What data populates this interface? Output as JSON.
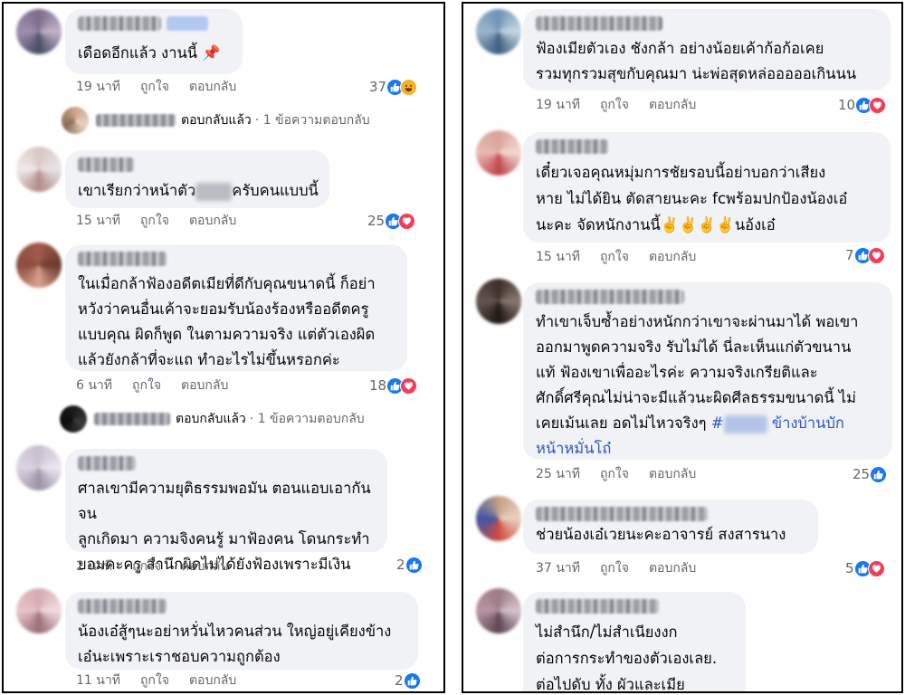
{
  "left_comments": [
    {
      "text": "เดือดอีกแล้ว งานนี้ 📌",
      "time": "19 นาที",
      "like": "ถูกใจ",
      "reply": "ตอบกลับ",
      "reaction_count": "37",
      "reactions": [
        "like",
        "haha"
      ],
      "replies_summary": {
        "replied": "ตอบกลับแล้ว",
        "count_text": "· 1 ข้อความตอบกลับ"
      }
    },
    {
      "text_before": "เขาเรียกว่าหน้าตัว",
      "text_after": "ครับคนแบบนี้",
      "time": "15 นาที",
      "like": "ถูกใจ",
      "reply": "ตอบกลับ",
      "reaction_count": "25",
      "reactions": [
        "like",
        "love"
      ]
    },
    {
      "lines": [
        "ในเมื่อกล้าฟ้องอดีตเมียที่ดีกับคุณขนาดนี้ ก็อย่า",
        "หวังว่าคนอื่นเค้าจะยอมรับน้องร้องหรืออดีตครู",
        "แบบคุณ ผิดก็พูด ในตามความจริง แต่ตัวเองผิด",
        "แล้วยังกล้าที่จะแถ ทำอะไรไม่ขึ้นหรอกค่ะ"
      ],
      "time": "6 นาที",
      "like": "ถูกใจ",
      "reply": "ตอบกลับ",
      "reaction_count": "18",
      "reactions": [
        "like",
        "love"
      ],
      "replies_summary": {
        "replied": "ตอบกลับแล้ว",
        "count_text": "· 1 ข้อความตอบกลับ"
      }
    },
    {
      "lines": [
        "ศาลเขามีความยุติธรรมพอมัน ตอนแอบเอากัน จน",
        "ลูกเกิดมา ความจิงคนรู้ มาฟ้องคน โดนกระทำ",
        "ยอมคะครู สำนึกผิดไม่ได้ยังฟ้องเพราะมีเงิน"
      ],
      "time": "2 นาที",
      "like": "ถูกใจ",
      "reply": "ตอบกลับ",
      "reaction_count": "2",
      "reactions": [
        "like"
      ]
    },
    {
      "lines": [
        "น้องเอ๋สู้ๆนะอย่าหวั่นไหวคนส่วน ใหญ่อยู่เคียงข้าง",
        "เอ๋นะเพราะเราชอบความถูกต้อง"
      ],
      "time": "11 นาที",
      "like": "ถูกใจ",
      "reply": "ตอบกลับ",
      "reaction_count": "2",
      "reactions": [
        "like"
      ]
    }
  ],
  "right_comments": [
    {
      "lines": [
        "ฟ้องเมียตัวเอง ชังกล้า อย่างน้อยเค้าก้อก้อเคย",
        "รวมทุกรวมสุขกับคุณมา น่ะพ่อสุดหล่อออออเกินนน"
      ],
      "time": "19 นาที",
      "like": "ถูกใจ",
      "reply": "ตอบกลับ",
      "reaction_count": "10",
      "reactions": [
        "like",
        "love"
      ]
    },
    {
      "lines": [
        "เดี๋ยวเจอคุณหมุ่มการชัยรอบนี้อย่าบอกว่าเสียง",
        "หาย ไม่ได้ยิน ตัดสายนะคะ fcพร้อมปกป้องน้องเอ๋",
        "นะคะ จัดหนักงานนี้✌️✌️✌️✌️นอ้งเอ๋"
      ],
      "time": "15 นาที",
      "like": "ถูกใจ",
      "reply": "ตอบกลับ",
      "reaction_count": "7",
      "reactions": [
        "like",
        "love"
      ]
    },
    {
      "lines": [
        "ทำเขาเจ็บซ้ำอย่างหนักกว่าเขาจะผ่านมาได้ พอเขา",
        "ออกมาพูดความจริง รับไม่ได้ นี่ละเห็นแก่ตัวขนาน",
        "แท้ ฟ้องเขาเพื่ออะไรค่ะ ความจริงเกรียติและ",
        "ศักดิ์ศรีคุณไม่น่าจะมีแล้วนะผิดศีลธรรมขนาดนี้ ไม่",
        "เคยเม้นเลย อดไม่ไหวจริงๆ"
      ],
      "hashtag_prefix": "#",
      "hashtag_suffix": "ข้างบ้านบัก",
      "hashtag_line2": "หน้าหมั่นโถ๋",
      "time": "25 นาที",
      "like": "ถูกใจ",
      "reply": "ตอบกลับ",
      "reaction_count": "25",
      "reactions": [
        "like"
      ]
    },
    {
      "lines": [
        "ช่วยน้องเอ๋เวยนะคะอาจารย์ สงสารนาง"
      ],
      "time": "37 นาที",
      "like": "ถูกใจ",
      "reply": "ตอบกลับ",
      "reaction_count": "5",
      "reactions": [
        "like",
        "love"
      ]
    },
    {
      "lines": [
        "ไม่สำนึก/ไม่สำเนียงงก",
        "ต่อการกระทำของตัวเองเลย.",
        "ต่อไปดับ ทั้ง ผัวและเมีย"
      ]
    }
  ],
  "colors": {
    "like": "#1877f2",
    "love": "#f33e58",
    "haha": "#f7b125",
    "bubble": "#f0f2f5",
    "meta": "#65676b",
    "hashtag": "#2d58c4"
  }
}
